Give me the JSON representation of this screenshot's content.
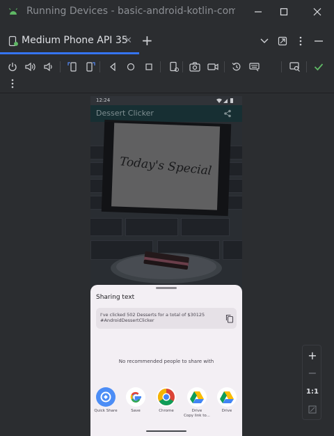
{
  "window": {
    "title": "Running Devices - basic-android-kotlin-compos"
  },
  "tabs": [
    {
      "label": "Medium Phone API 35",
      "active": true,
      "icon": "device-icon"
    }
  ],
  "device": {
    "status_time": "12:24",
    "app_title": "Dessert Clicker",
    "scene_text": "Today's Special"
  },
  "share_sheet": {
    "title": "Sharing text",
    "preview_text": "I've clicked 502 Desserts for a total of $30125 #AndroidDessertClicker",
    "no_people": "No recommended people to share with",
    "targets": [
      {
        "label": "Quick Share",
        "icon": "quick-share-icon"
      },
      {
        "label": "Save",
        "icon": "google-icon"
      },
      {
        "label": "Chrome",
        "icon": "chrome-icon"
      },
      {
        "label": "Drive\nCopy link to...",
        "icon": "drive-icon"
      },
      {
        "label": "Drive",
        "icon": "drive-icon"
      }
    ]
  },
  "zoom": {
    "zoom_in": "+",
    "zoom_out": "−",
    "actual_size": "1:1"
  },
  "colors": {
    "accent": "#3574f0",
    "success": "#5fb865",
    "ide_background": "#2b2d30",
    "sheet_background": "#f3eff4"
  }
}
